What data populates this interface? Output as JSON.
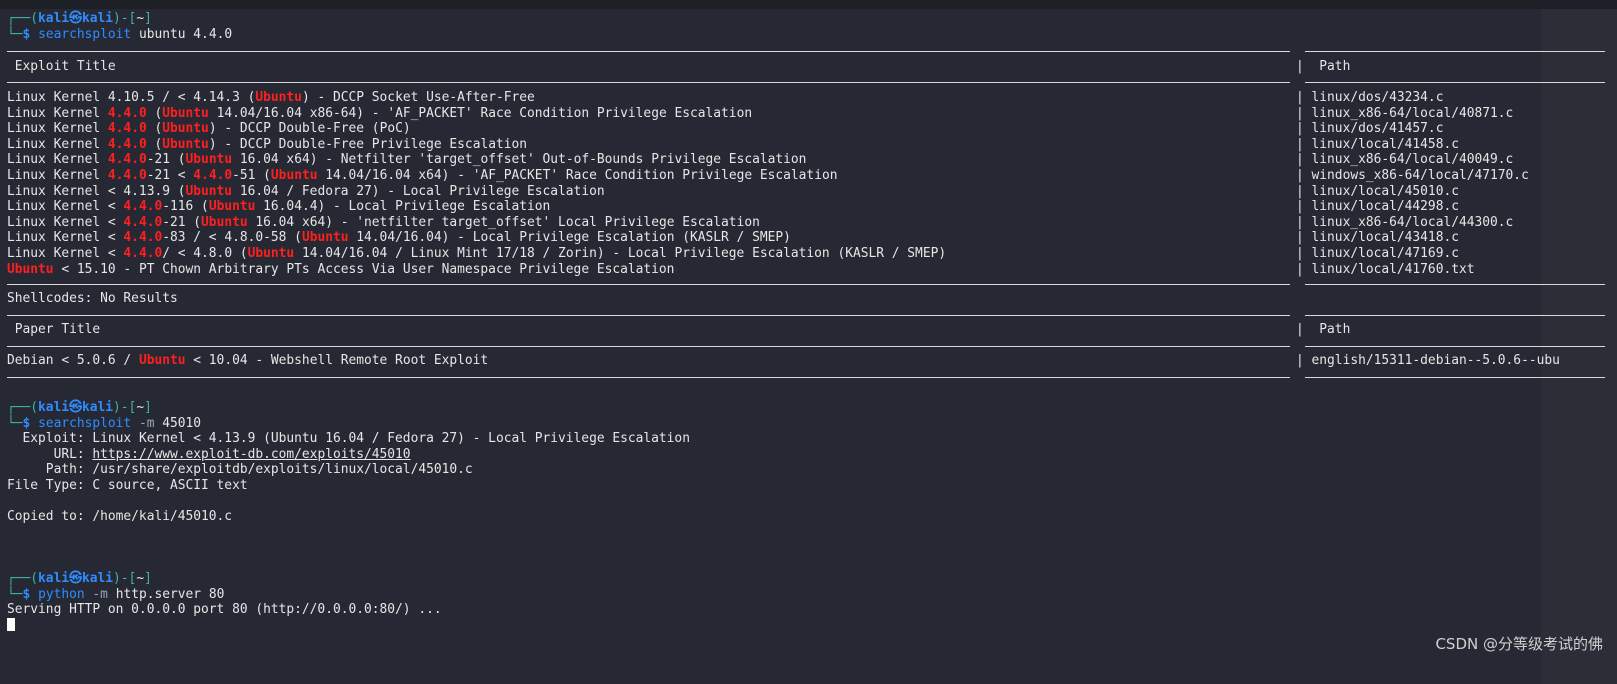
{
  "prompt": {
    "user": "kali",
    "host": "kali",
    "at_icon": "kali-dragon-icon",
    "dir": "~"
  },
  "session1": {
    "command": "searchsploit",
    "args": "ubuntu 4.4.0",
    "exploit_header": "Exploit Title",
    "path_header": "Path",
    "rows": [
      {
        "segments": [
          {
            "t": "Linux Kernel 4.10.5 / < 4.14.3 ("
          },
          {
            "t": "Ubuntu",
            "red": true
          },
          {
            "t": ") - DCCP Socket Use-After-Free"
          }
        ],
        "path": "linux/dos/43234.c"
      },
      {
        "segments": [
          {
            "t": "Linux Kernel "
          },
          {
            "t": "4.4.0",
            "red": true
          },
          {
            "t": " ("
          },
          {
            "t": "Ubuntu",
            "red": true
          },
          {
            "t": " 14.04/16.04 x86-64) - 'AF_PACKET' Race Condition Privilege Escalation"
          }
        ],
        "path": "linux_x86-64/local/40871.c"
      },
      {
        "segments": [
          {
            "t": "Linux Kernel "
          },
          {
            "t": "4.4.0",
            "red": true
          },
          {
            "t": " ("
          },
          {
            "t": "Ubuntu",
            "red": true
          },
          {
            "t": ") - DCCP Double-Free (PoC)"
          }
        ],
        "path": "linux/dos/41457.c"
      },
      {
        "segments": [
          {
            "t": "Linux Kernel "
          },
          {
            "t": "4.4.0",
            "red": true
          },
          {
            "t": " ("
          },
          {
            "t": "Ubuntu",
            "red": true
          },
          {
            "t": ") - DCCP Double-Free Privilege Escalation"
          }
        ],
        "path": "linux/local/41458.c"
      },
      {
        "segments": [
          {
            "t": "Linux Kernel "
          },
          {
            "t": "4.4.0",
            "red": true
          },
          {
            "t": "-21 ("
          },
          {
            "t": "Ubuntu",
            "red": true
          },
          {
            "t": " 16.04 x64) - Netfilter 'target_offset' Out-of-Bounds Privilege Escalation"
          }
        ],
        "path": "linux_x86-64/local/40049.c"
      },
      {
        "segments": [
          {
            "t": "Linux Kernel "
          },
          {
            "t": "4.4.0",
            "red": true
          },
          {
            "t": "-21 < "
          },
          {
            "t": "4.4.0",
            "red": true
          },
          {
            "t": "-51 ("
          },
          {
            "t": "Ubuntu",
            "red": true
          },
          {
            "t": " 14.04/16.04 x64) - 'AF_PACKET' Race Condition Privilege Escalation"
          }
        ],
        "path": "windows_x86-64/local/47170.c"
      },
      {
        "segments": [
          {
            "t": "Linux Kernel < 4.13.9 ("
          },
          {
            "t": "Ubuntu",
            "red": true
          },
          {
            "t": " 16.04 / Fedora 27) - Local Privilege Escalation"
          }
        ],
        "path": "linux/local/45010.c"
      },
      {
        "segments": [
          {
            "t": "Linux Kernel < "
          },
          {
            "t": "4.4.0",
            "red": true
          },
          {
            "t": "-116 ("
          },
          {
            "t": "Ubuntu",
            "red": true
          },
          {
            "t": " 16.04.4) - Local Privilege Escalation"
          }
        ],
        "path": "linux/local/44298.c"
      },
      {
        "segments": [
          {
            "t": "Linux Kernel < "
          },
          {
            "t": "4.4.0",
            "red": true
          },
          {
            "t": "-21 ("
          },
          {
            "t": "Ubuntu",
            "red": true
          },
          {
            "t": " 16.04 x64) - 'netfilter target_offset' Local Privilege Escalation"
          }
        ],
        "path": "linux_x86-64/local/44300.c"
      },
      {
        "segments": [
          {
            "t": "Linux Kernel < "
          },
          {
            "t": "4.4.0",
            "red": true
          },
          {
            "t": "-83 / < 4.8.0-58 ("
          },
          {
            "t": "Ubuntu",
            "red": true
          },
          {
            "t": " 14.04/16.04) - Local Privilege Escalation (KASLR / SMEP)"
          }
        ],
        "path": "linux/local/43418.c"
      },
      {
        "segments": [
          {
            "t": "Linux Kernel < "
          },
          {
            "t": "4.4.0",
            "red": true
          },
          {
            "t": "/ < 4.8.0 ("
          },
          {
            "t": "Ubuntu",
            "red": true
          },
          {
            "t": " 14.04/16.04 / Linux Mint 17/18 / Zorin) - Local Privilege Escalation (KASLR / SMEP)"
          }
        ],
        "path": "linux/local/47169.c"
      },
      {
        "segments": [
          {
            "t": "Ubuntu",
            "red": true
          },
          {
            "t": " < 15.10 - PT Chown Arbitrary PTs Access Via User Namespace Privilege Escalation"
          }
        ],
        "path": "linux/local/41760.txt"
      }
    ],
    "shellcodes": "Shellcodes: No Results",
    "paper_header": "Paper Title",
    "paper_rows": [
      {
        "segments": [
          {
            "t": "Debian < 5.0.6 / "
          },
          {
            "t": "Ubuntu",
            "red": true
          },
          {
            "t": " < 10.04 - Webshell Remote Root Exploit"
          }
        ],
        "path": "english/15311-debian--5.0.6--ubu"
      }
    ]
  },
  "session2": {
    "command": "searchsploit",
    "opt": "-m",
    "args": "45010",
    "exploit_label": "  Exploit: ",
    "exploit": "Linux Kernel < 4.13.9 (Ubuntu 16.04 / Fedora 27) - Local Privilege Escalation",
    "url_label": "      URL: ",
    "url": "https://www.exploit-db.com/exploits/45010",
    "path_label": "     Path: ",
    "path": "/usr/share/exploitdb/exploits/linux/local/45010.c",
    "filetype": "File Type: C source, ASCII text",
    "copied": "Copied to: /home/kali/45010.c"
  },
  "session3": {
    "command": "python",
    "opt": "-m",
    "args": "http.server 80",
    "output": "Serving HTTP on 0.0.0.0 port 80 (http://0.0.0.0:80/) ..."
  },
  "watermark": "CSDN @分等级考试的佛"
}
